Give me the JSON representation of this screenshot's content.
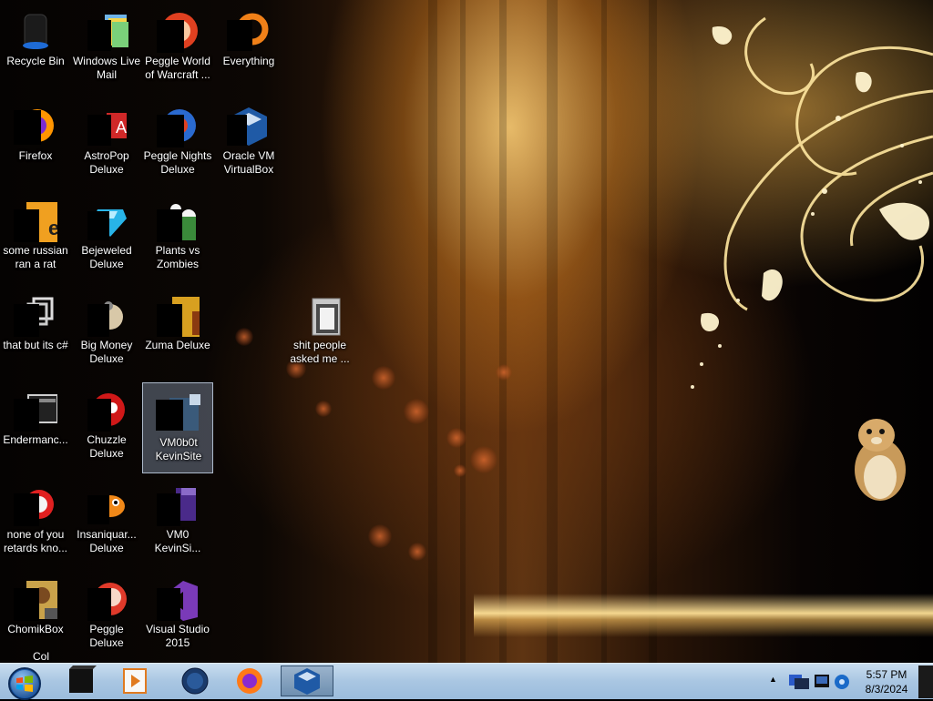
{
  "desktop": {
    "icons": [
      {
        "label": "Recycle Bin"
      },
      {
        "label": "Windows Live Mail"
      },
      {
        "label": "Peggle World of Warcraft ..."
      },
      {
        "label": "Everything"
      },
      {
        "label": "Firefox"
      },
      {
        "label": "AstroPop Deluxe"
      },
      {
        "label": "Peggle Nights Deluxe"
      },
      {
        "label": "Oracle VM VirtualBox"
      },
      {
        "label": "some russian ran a rat"
      },
      {
        "label": "Bejeweled Deluxe"
      },
      {
        "label": "Plants vs Zombies"
      },
      {
        "label": "that but its c#"
      },
      {
        "label": "Big Money Deluxe"
      },
      {
        "label": "Zuma Deluxe"
      },
      {
        "label": "shit people asked me ..."
      },
      {
        "label": "Endermanc..."
      },
      {
        "label": "Chuzzle Deluxe"
      },
      {
        "label": "VM0b0t KevinSite"
      },
      {
        "label": "none of you retards kno..."
      },
      {
        "label": "Insaniquar... Deluxe"
      },
      {
        "label": "VM0 KevinSi..."
      },
      {
        "label": "ChomikBox"
      },
      {
        "label": "Peggle Deluxe"
      },
      {
        "label": "Visual Studio 2015"
      }
    ],
    "partial_label": "Col"
  },
  "taskbar": {
    "pinned": [
      {
        "icon": "black-box-app-icon"
      },
      {
        "icon": "media-player-icon"
      },
      {
        "icon": "globe-app-icon"
      },
      {
        "icon": "firefox-icon"
      },
      {
        "icon": "virtualbox-icon"
      }
    ],
    "tray": {
      "expand": "▲"
    },
    "clock": {
      "time": "5:57 PM",
      "date": "8/3/2024"
    }
  }
}
